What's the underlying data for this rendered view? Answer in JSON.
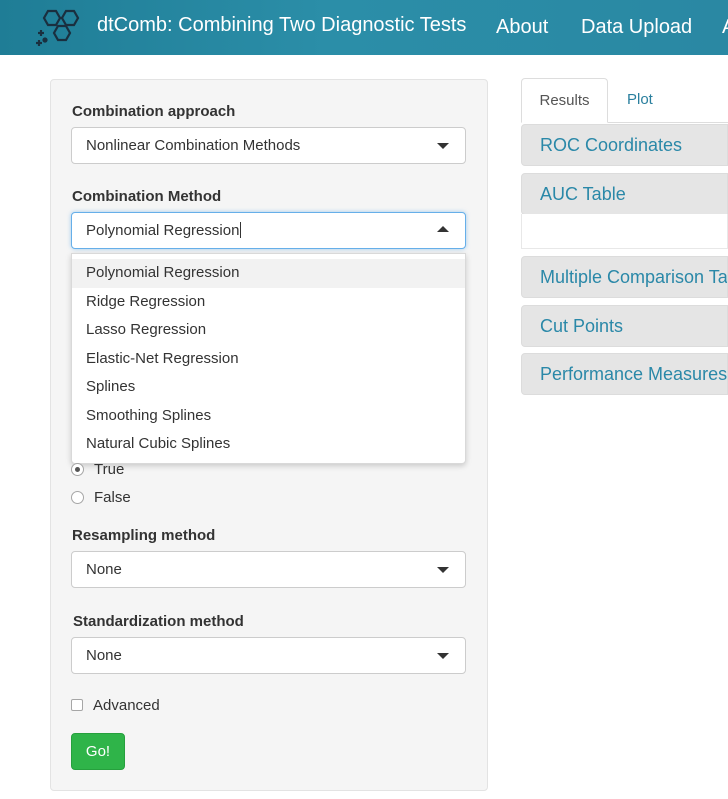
{
  "header": {
    "title": "dtComb: Combining Two Diagnostic Tests",
    "nav": [
      "About",
      "Data Upload",
      "A"
    ]
  },
  "form": {
    "combination_approach": {
      "label": "Combination approach",
      "value": "Nonlinear Combination Methods"
    },
    "combination_method": {
      "label": "Combination Method",
      "value": "Polynomial Regression",
      "options": [
        "Polynomial Regression",
        "Ridge Regression",
        "Lasso Regression",
        "Elastic-Net Regression",
        "Splines",
        "Smoothing Splines",
        "Natural Cubic Splines"
      ]
    },
    "radio_options": [
      {
        "label": "True",
        "checked": true
      },
      {
        "label": "False",
        "checked": false
      }
    ],
    "resampling": {
      "label": "Resampling method",
      "value": "None"
    },
    "standardization": {
      "label": "Standardization method",
      "value": "None"
    },
    "advanced_label": "Advanced",
    "go_label": "Go!"
  },
  "results": {
    "tabs": [
      "Results",
      "Plot"
    ],
    "sections": [
      "ROC Coordinates",
      "AUC Table",
      "Multiple Comparison Table",
      "Cut Points",
      "Performance Measures"
    ]
  }
}
